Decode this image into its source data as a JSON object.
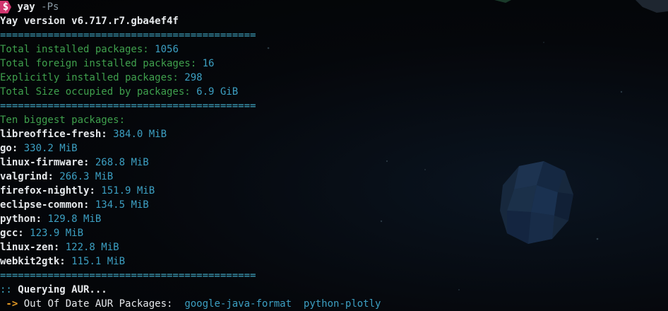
{
  "prompt": {
    "symbol": "$",
    "command": "yay",
    "args": "-Ps"
  },
  "version_line": "Yay version v6.717.r7.gba4ef4f",
  "separator": "===========================================",
  "stats": [
    {
      "label": "Total installed packages: ",
      "value": "1056"
    },
    {
      "label": "Total foreign installed packages: ",
      "value": "16"
    },
    {
      "label": "Explicitly installed packages: ",
      "value": "298"
    },
    {
      "label": "Total Size occupied by packages: ",
      "value": "6.9 GiB"
    }
  ],
  "biggest_heading": "Ten biggest packages:",
  "packages": [
    {
      "name": "libreoffice-fresh",
      "size": "384.0 MiB"
    },
    {
      "name": "go",
      "size": "330.2 MiB"
    },
    {
      "name": "linux-firmware",
      "size": "268.8 MiB"
    },
    {
      "name": "valgrind",
      "size": "266.3 MiB"
    },
    {
      "name": "firefox-nightly",
      "size": "151.9 MiB"
    },
    {
      "name": "eclipse-common",
      "size": "134.5 MiB"
    },
    {
      "name": "python",
      "size": "129.8 MiB"
    },
    {
      "name": "gcc",
      "size": "123.9 MiB"
    },
    {
      "name": "linux-zen",
      "size": "122.8 MiB"
    },
    {
      "name": "webkit2gtk",
      "size": "115.1 MiB"
    }
  ],
  "aur_query": {
    "prefix": "::",
    "text": " Querying AUR..."
  },
  "out_of_date": {
    "arrow": " ->",
    "label": " Out Of Date AUR Packages:",
    "packages": [
      "google-java-format",
      "python-plotly"
    ]
  },
  "colors": {
    "badge": "#d1356e",
    "label_green": "#3fa04d",
    "value_blue": "#3c9fc2",
    "arrow_orange": "#e39a25",
    "background": "#05070a"
  }
}
